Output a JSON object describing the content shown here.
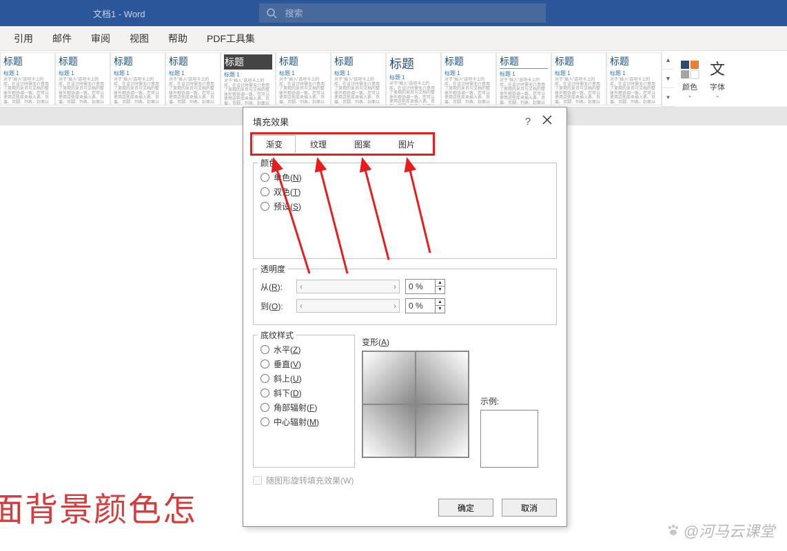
{
  "titlebar": {
    "doc_title": "文档1 - Word",
    "search_placeholder": "搜索"
  },
  "ribbon": {
    "tabs": [
      "引用",
      "邮件",
      "审阅",
      "视图",
      "帮助",
      "PDF工具集"
    ]
  },
  "gallery": {
    "style_big": "标题",
    "style_med": "标题 1",
    "style_tiny": "对于\"插入\"选项卡上的库，在设计时需无介意用了美观的采页与文档的整体外观协调一致。您可以使用这些库来插入表、页眉、页脚、列表、封面以及其他"
  },
  "side_tools": {
    "color": "颜色",
    "font": "字体"
  },
  "dialog": {
    "title": "填充效果",
    "tabs": {
      "gradient": "渐变",
      "texture": "纹理",
      "pattern": "图案",
      "picture": "图片"
    },
    "color_group": {
      "legend": "颜色",
      "one": "单色(",
      "one_u": "N",
      "two": "双色(",
      "two_u": "T",
      "preset": "预设(",
      "preset_u": "S"
    },
    "trans_group": {
      "legend": "透明度",
      "from": "从(",
      "from_u": "R",
      "to": "到(",
      "to_u": "O",
      "val": "0 %"
    },
    "shading_group": {
      "legend": "底纹样式",
      "horiz": "水平(",
      "horiz_u": "Z",
      "vert": "垂直(",
      "vert_u": "V",
      "diag_up": "斜上(",
      "diag_up_u": "U",
      "diag_down": "斜下(",
      "diag_down_u": "D",
      "corner": "角部辐射(",
      "corner_u": "F",
      "center": "中心辐射(",
      "center_u": "M"
    },
    "variant_label": "变形(",
    "variant_u": "A",
    "sample_label": "示例:",
    "rotate_label": "随图形旋转填充效果(W)",
    "ok": "确定",
    "cancel": "取消"
  },
  "bg_text": "面背景颜色怎",
  "watermark": "@河马云课堂",
  "closing": ")",
  "colon": "):"
}
